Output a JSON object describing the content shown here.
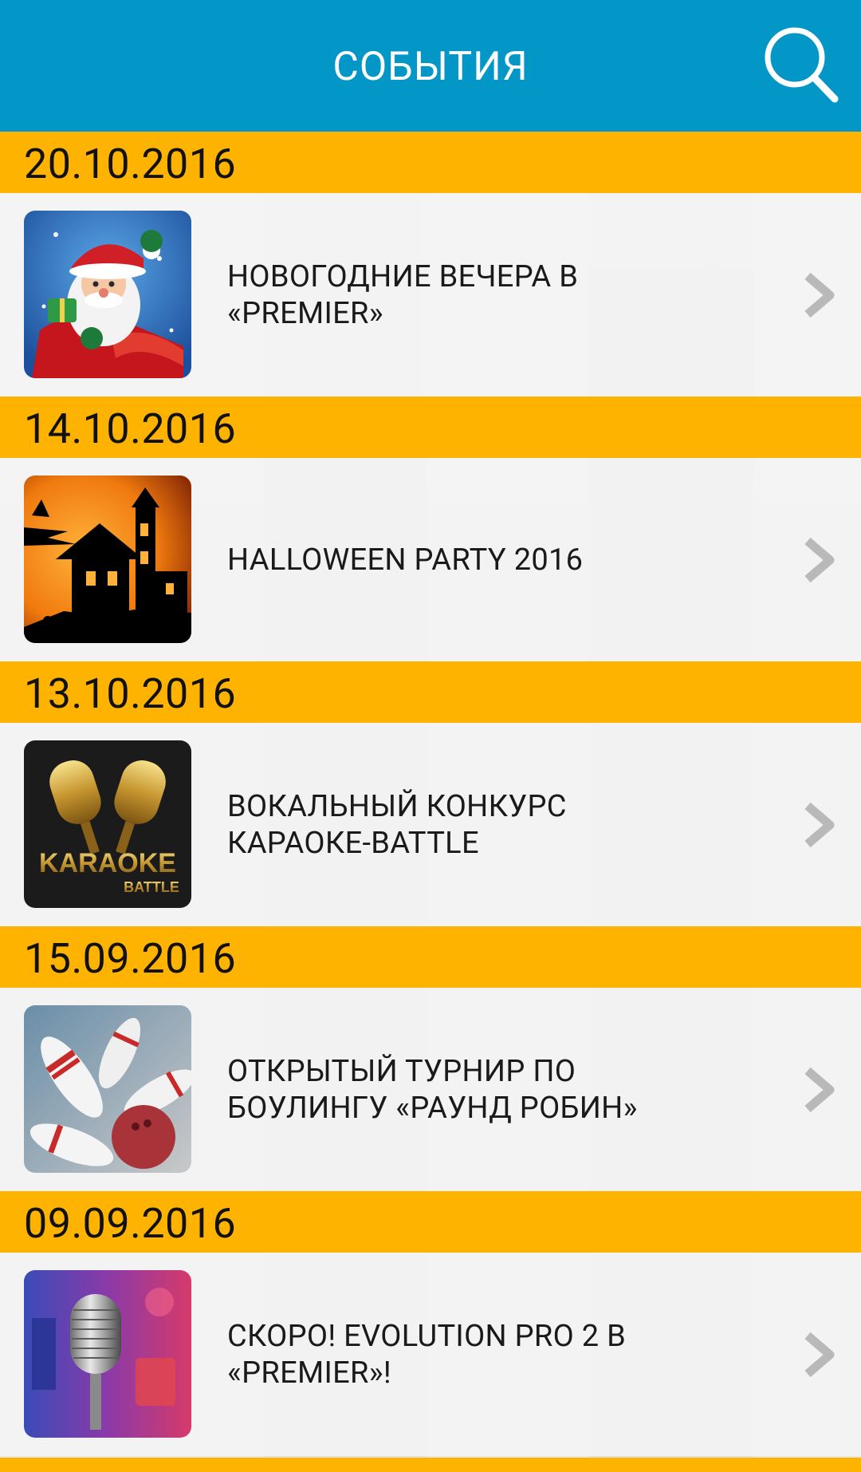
{
  "header": {
    "title": "СОБЫТИЯ",
    "search_icon": "search-icon"
  },
  "colors": {
    "header_bg": "#0397c8",
    "date_bar": "#fdb300",
    "chevron": "#b9b9b9"
  },
  "events": [
    {
      "date": "20.10.2016",
      "title": "НОВОГОДНИЕ ВЕЧЕРА В\n«PREMIER»",
      "thumbnail": "santa-claus-image"
    },
    {
      "date": "14.10.2016",
      "title": "HALLOWEEN PARTY 2016",
      "thumbnail": "haunted-house-image"
    },
    {
      "date": "13.10.2016",
      "title": "ВОКАЛЬНЫЙ КОНКУРС\nКАРАОКЕ-BATTLE",
      "thumbnail": "karaoke-battle-image",
      "thumbnail_text": "KARAOKE",
      "thumbnail_subtext": "BATTLE"
    },
    {
      "date": "15.09.2016",
      "title": "ОТКРЫТЫЙ ТУРНИР ПО\nБОУЛИНГУ «РАУНД РОБИН»",
      "thumbnail": "bowling-pins-image"
    },
    {
      "date": "09.09.2016",
      "title": "СКОРО! EVOLUTION PRO 2 В\n«PREMIER»!",
      "thumbnail": "microphone-image"
    }
  ]
}
